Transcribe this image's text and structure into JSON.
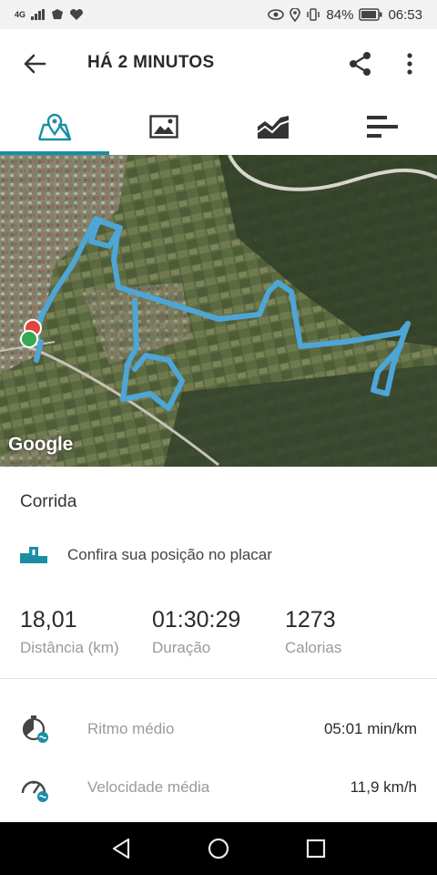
{
  "status": {
    "network": "4G",
    "battery": "84%",
    "time": "06:53"
  },
  "header": {
    "title": "HÁ 2 MINUTOS"
  },
  "tabs": [
    {
      "name": "map-icon",
      "active": true
    },
    {
      "name": "photo-icon",
      "active": false
    },
    {
      "name": "chart-icon",
      "active": false
    },
    {
      "name": "laps-icon",
      "active": false
    }
  ],
  "map": {
    "attribution": "Google"
  },
  "activity": {
    "type": "Corrida",
    "leaderboard_text": "Confira sua posição no placar"
  },
  "stats": {
    "distance": {
      "value": "18,01",
      "label": "Distância (km)"
    },
    "duration": {
      "value": "01:30:29",
      "label": "Duração"
    },
    "calories": {
      "value": "1273",
      "label": "Calorias"
    }
  },
  "metrics": {
    "pace": {
      "label": "Ritmo médio",
      "value": "05:01 min/km"
    },
    "speed": {
      "label": "Velocidade média",
      "value": "11,9 km/h"
    }
  },
  "colors": {
    "accent": "#1b8ea5",
    "route": "#4da6d6"
  }
}
